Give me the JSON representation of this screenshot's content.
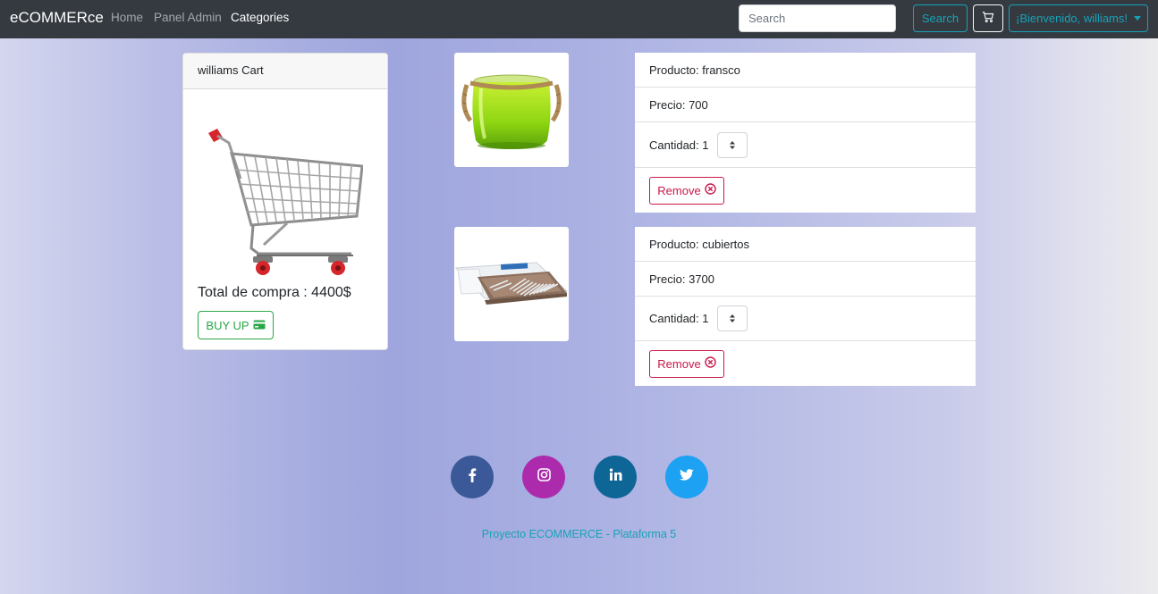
{
  "navbar": {
    "brand": "eCOMMERce",
    "links": [
      "Home",
      "Panel Admin",
      "Categories"
    ],
    "search_placeholder": "Search",
    "search_button": "Search",
    "user_menu": "¡Bienvenido, williams!"
  },
  "cart": {
    "header": "williams Cart",
    "total_label": "Total de compra : 4400$",
    "buy_button": "BUY UP"
  },
  "products": [
    {
      "name": "Producto: fransco",
      "price": "Precio: 700",
      "quantity_label": "Cantidad: 1",
      "remove_label": "Remove"
    },
    {
      "name": "Producto: cubiertos",
      "price": "Precio: 3700",
      "quantity_label": "Cantidad: 1",
      "remove_label": "Remove"
    }
  ],
  "social": {
    "icons": [
      "facebook-icon",
      "instagram-icon",
      "linkedin-icon",
      "twitter-icon"
    ],
    "colors": [
      "#3b5998",
      "#ac2bac",
      "#0e6697",
      "#1da1f2"
    ]
  },
  "footer": {
    "text": "Proyecto ECOMMERCE - Plataforma 5"
  },
  "colors": {
    "navbar_bg": "#343a40",
    "info": "#17a2b8",
    "success": "#28a745",
    "danger": "#c9184a"
  }
}
